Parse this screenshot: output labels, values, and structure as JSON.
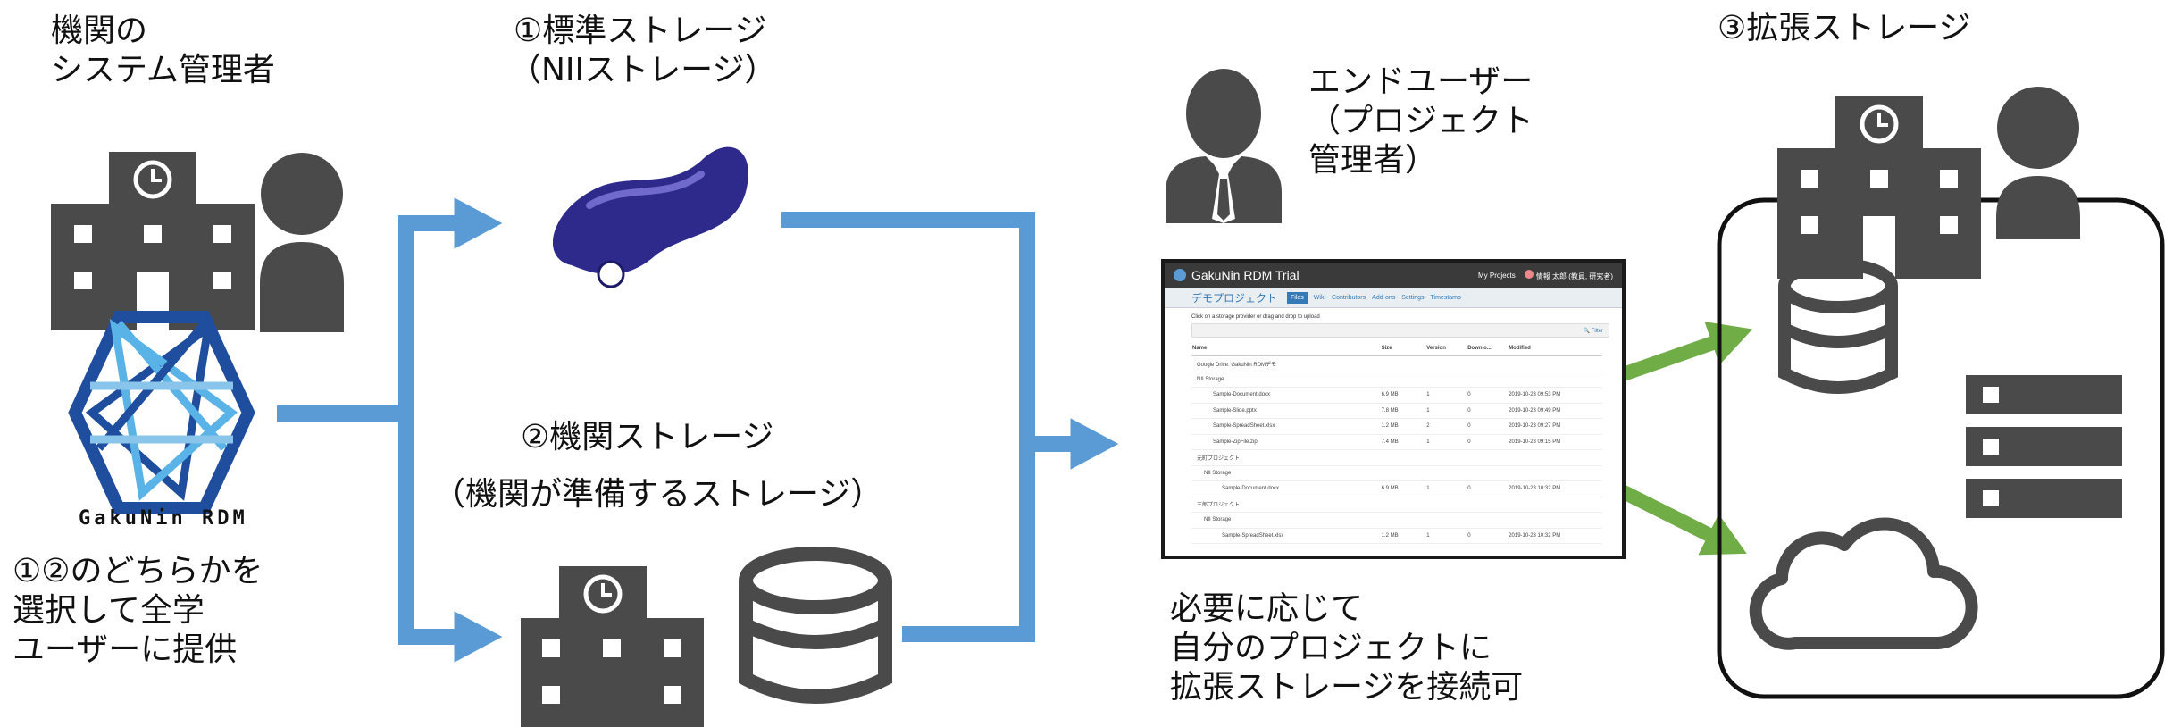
{
  "labels": {
    "admin": "機関の\nシステム管理者",
    "nii_storage_line1": "①標準ストレージ",
    "nii_storage_line2": "（NIIストレージ）",
    "gakunin_logo_text": "GakuNin RDM",
    "choice_note": "①②のどちらかを\n選択して全学\nユーザーに提供",
    "inst_storage_line1": "②機関ストレージ",
    "inst_storage_line2": "（機関が準備するストレージ）",
    "enduser": "エンドユーザー\n（プロジェクト\n管理者）",
    "connect_note": "必要に応じて\n自分のプロジェクトに\n拡張ストレージを接続可",
    "ext_storage": "③拡張ストレージ"
  },
  "screenshot": {
    "app_title": "GakuNin RDM Trial",
    "my_projects": "My Projects",
    "user_name": "情報 太郎 (教員, 研究者)",
    "project_name": "デモプロジェクト",
    "tabs": [
      "Files",
      "Wiki",
      "Contributors",
      "Add-ons",
      "Settings",
      "Timestamp"
    ],
    "active_tab": "Files",
    "hint": "Click on a storage provider or drag and drop to upload",
    "filter_label": "Filter",
    "columns": [
      "Name",
      "Size",
      "Version",
      "Downlo...",
      "Modified"
    ],
    "rows": [
      {
        "name": "Google Drive: GakuNin RDMデモ",
        "size": "",
        "version": "",
        "downloads": "",
        "modified": "",
        "level": 0
      },
      {
        "name": "NII Storage",
        "size": "",
        "version": "",
        "downloads": "",
        "modified": "",
        "level": 0
      },
      {
        "name": "Sample-Document.docx",
        "size": "6.9 MB",
        "version": "1",
        "downloads": "0",
        "modified": "2019-10-23 09:53 PM",
        "level": 2
      },
      {
        "name": "Sample-Slide.pptx",
        "size": "7.8 MB",
        "version": "1",
        "downloads": "0",
        "modified": "2019-10-23 09:49 PM",
        "level": 2
      },
      {
        "name": "Sample-SpreadSheet.xlsx",
        "size": "1.2 MB",
        "version": "2",
        "downloads": "0",
        "modified": "2019-10-23 09:27 PM",
        "level": 2
      },
      {
        "name": "Sample-ZipFile.zip",
        "size": "7.4 MB",
        "version": "1",
        "downloads": "0",
        "modified": "2019-10-23 09:15 PM",
        "level": 2
      },
      {
        "name": "元町プロジェクト",
        "size": "",
        "version": "",
        "downloads": "",
        "modified": "",
        "level": 0
      },
      {
        "name": "NII Storage",
        "size": "",
        "version": "",
        "downloads": "",
        "modified": "",
        "level": 1
      },
      {
        "name": "Sample-Document.docx",
        "size": "6.9 MB",
        "version": "1",
        "downloads": "0",
        "modified": "2019-10-23 10:32 PM",
        "level": 3
      },
      {
        "name": "三郎プロジェクト",
        "size": "",
        "version": "",
        "downloads": "",
        "modified": "",
        "level": 0
      },
      {
        "name": "NII Storage",
        "size": "",
        "version": "",
        "downloads": "",
        "modified": "",
        "level": 1
      },
      {
        "name": "Sample-SpreadSheet.xlsx",
        "size": "1.2 MB",
        "version": "1",
        "downloads": "0",
        "modified": "2019-10-23 10:32 PM",
        "level": 3
      }
    ]
  },
  "colors": {
    "flow_blue": "#5b9bd5",
    "flow_green": "#70ad47",
    "icon_gray": "#4a4a4a",
    "key_purple": "#2e2a8c",
    "logo_dark": "#1f4e9e",
    "logo_light": "#5ab3e6"
  },
  "icons": [
    "building-icon",
    "person-icon",
    "gakunin-rdm-logo",
    "usb-key-icon",
    "database-icon",
    "businessman-icon",
    "server-icon",
    "cloud-icon"
  ]
}
